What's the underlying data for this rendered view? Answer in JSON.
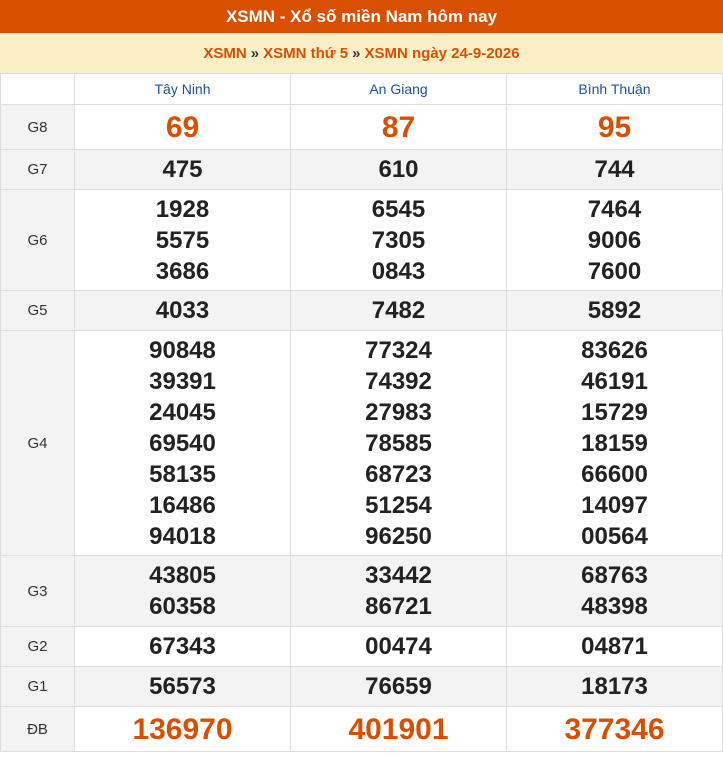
{
  "header": {
    "title": "XSMN - Xổ số miền Nam hôm nay"
  },
  "breadcrumb": {
    "items": [
      "XSMN",
      "XSMN thứ 5",
      "XSMN ngày 24-9-2026"
    ],
    "separator": "»"
  },
  "colors": {
    "accent": "#d94f00",
    "breadcrumb_bg": "#fbefc8",
    "province_text": "#1b4fa0",
    "row_alt": "#f3f3f3"
  },
  "provinces": [
    "Tây Ninh",
    "An Giang",
    "Bình Thuận"
  ],
  "prizes": [
    {
      "label": "G8",
      "values": [
        [
          "69"
        ],
        [
          "87"
        ],
        [
          "95"
        ]
      ]
    },
    {
      "label": "G7",
      "values": [
        [
          "475"
        ],
        [
          "610"
        ],
        [
          "744"
        ]
      ]
    },
    {
      "label": "G6",
      "values": [
        [
          "1928",
          "5575",
          "3686"
        ],
        [
          "6545",
          "7305",
          "0843"
        ],
        [
          "7464",
          "9006",
          "7600"
        ]
      ]
    },
    {
      "label": "G5",
      "values": [
        [
          "4033"
        ],
        [
          "7482"
        ],
        [
          "5892"
        ]
      ]
    },
    {
      "label": "G4",
      "values": [
        [
          "90848",
          "39391",
          "24045",
          "69540",
          "58135",
          "16486",
          "94018"
        ],
        [
          "77324",
          "74392",
          "27983",
          "78585",
          "68723",
          "51254",
          "96250"
        ],
        [
          "83626",
          "46191",
          "15729",
          "18159",
          "66600",
          "14097",
          "00564"
        ]
      ]
    },
    {
      "label": "G3",
      "values": [
        [
          "43805",
          "60358"
        ],
        [
          "33442",
          "86721"
        ],
        [
          "68763",
          "48398"
        ]
      ]
    },
    {
      "label": "G2",
      "values": [
        [
          "67343"
        ],
        [
          "00474"
        ],
        [
          "04871"
        ]
      ]
    },
    {
      "label": "G1",
      "values": [
        [
          "56573"
        ],
        [
          "76659"
        ],
        [
          "18173"
        ]
      ]
    },
    {
      "label": "ĐB",
      "values": [
        [
          "136970"
        ],
        [
          "401901"
        ],
        [
          "377346"
        ]
      ]
    }
  ]
}
